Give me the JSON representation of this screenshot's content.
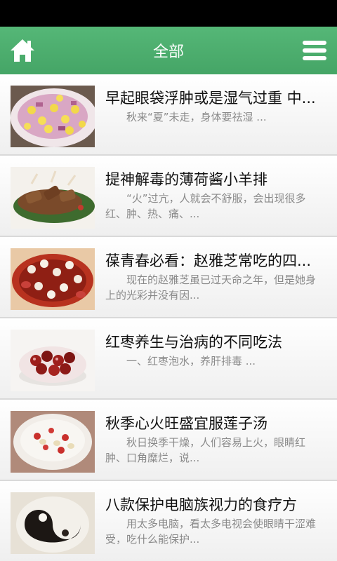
{
  "header": {
    "title": "全部",
    "home_icon": "home-icon",
    "menu_icon": "hamburger-menu-icon",
    "background_color": "#4caf6e"
  },
  "articles": [
    {
      "title": "早起眼袋浮肿或是湿气过重 中...",
      "summary": "秋来“夏”未走，身体要祛湿 ..."
    },
    {
      "title": "提神解毒的薄荷酱小羊排",
      "summary": "“火”过亢，人就会不舒服，会出现很多红、肿、热、痛、..."
    },
    {
      "title": "葆青春必看：赵雅芝常吃的四...",
      "summary": "现在的赵雅芝虽已过天命之年，但是她身上的光彩并没有因..."
    },
    {
      "title": "红枣养生与治病的不同吃法",
      "summary": "一、红枣泡水，养肝排毒 ..."
    },
    {
      "title": "秋季心火旺盛宜服莲子汤",
      "summary": "秋日换季干燥，人们容易上火，眼睛红肿、口角糜烂，说..."
    },
    {
      "title": "八款保护电脑族视力的食疗方",
      "summary": "用太多电脑，看太多电视会使眼睛干涩难受，吃什么能保护..."
    }
  ]
}
